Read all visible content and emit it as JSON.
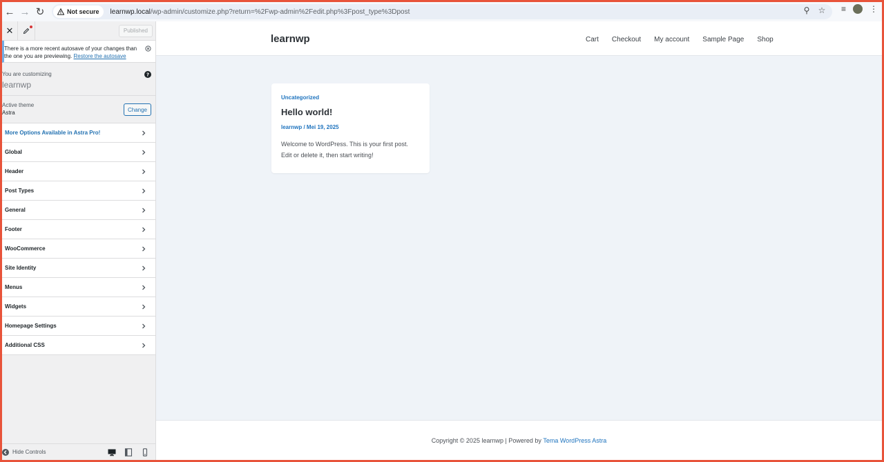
{
  "browser": {
    "security_label": "Not secure",
    "url_host": "learnwp.local",
    "url_path": "/wp-admin/customize.php?return=%2Fwp-admin%2Fedit.php%3Fpost_type%3Dpost"
  },
  "sidebar": {
    "published_label": "Published",
    "autosave_text": "There is a more recent autosave of your changes than the one you are previewing.",
    "autosave_link": "Restore the autosave",
    "customizing_label": "You are customizing",
    "site_name": "learnwp",
    "active_theme_label": "Active theme",
    "theme_name": "Astra",
    "change_label": "Change",
    "sections": [
      {
        "label": "More Options Available in Astra Pro!"
      },
      {
        "label": "Global"
      },
      {
        "label": "Header"
      },
      {
        "label": "Post Types"
      },
      {
        "label": "General"
      },
      {
        "label": "Footer"
      },
      {
        "label": "WooCommerce"
      },
      {
        "label": "Site Identity"
      },
      {
        "label": "Menus"
      },
      {
        "label": "Widgets"
      },
      {
        "label": "Homepage Settings"
      },
      {
        "label": "Additional CSS"
      }
    ],
    "hide_controls_label": "Hide Controls"
  },
  "preview": {
    "site_title": "learnwp",
    "nav": [
      {
        "label": "Cart"
      },
      {
        "label": "Checkout"
      },
      {
        "label": "My account"
      },
      {
        "label": "Sample Page"
      },
      {
        "label": "Shop"
      }
    ],
    "post": {
      "category": "Uncategorized",
      "title": "Hello world!",
      "meta": "learnwp / Mei 19, 2025",
      "excerpt": "Welcome to WordPress. This is your first post. Edit or delete it, then start writing!"
    },
    "footer_text": "Copyright © 2025 learnwp | Powered by ",
    "footer_link": "Tema WordPress Astra"
  },
  "colors": {
    "accent": "#2271b1",
    "astra_link": "#1e73be",
    "frame_border": "#e8533a"
  }
}
